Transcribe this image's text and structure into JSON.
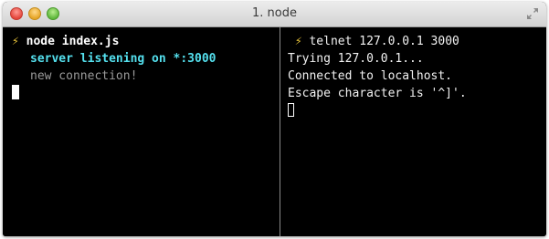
{
  "window": {
    "title": "1. node"
  },
  "left_pane": {
    "prompt_symbol": "⚡",
    "command": "node index.js",
    "output": [
      "server listening on *:3000",
      "new connection!"
    ]
  },
  "right_pane": {
    "prompt_symbol": "⚡",
    "command": "telnet 127.0.0.1 3000",
    "output": [
      "Trying 127.0.0.1...",
      "Connected to localhost.",
      "Escape character is '^]'."
    ]
  },
  "colors": {
    "prompt_bolt": "#e8c33a",
    "highlight_output": "#54e0ee",
    "dim_output": "#9a9a9a",
    "terminal_bg": "#000000"
  },
  "icons": {
    "close": "close-icon",
    "minimize": "minimize-icon",
    "zoom": "zoom-icon",
    "resize": "fullscreen-icon"
  }
}
